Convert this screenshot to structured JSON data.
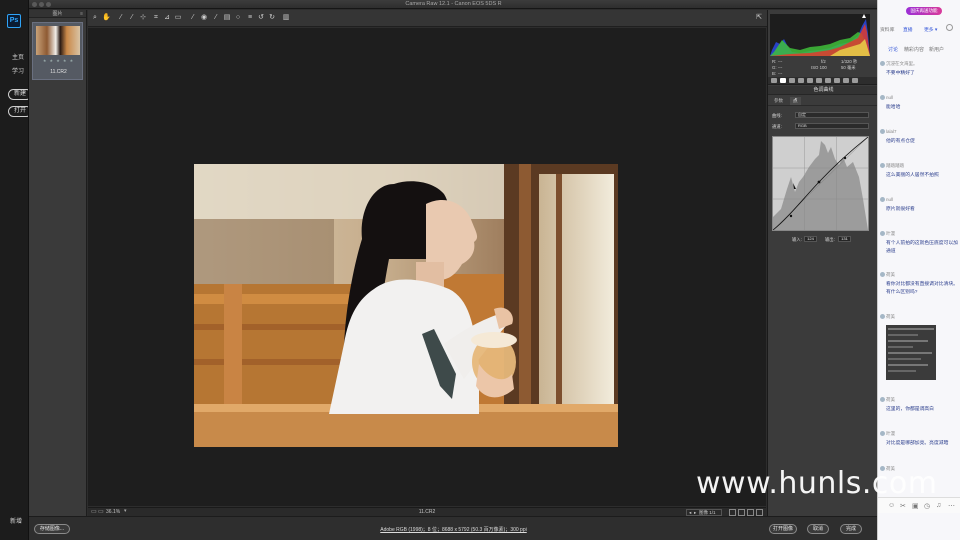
{
  "ps": {
    "logo": "Ps",
    "home": "主页",
    "learn": "学习",
    "new_btn": "新建",
    "open_btn": "打开",
    "footer": "新增"
  },
  "window": {
    "title": "Camera Raw 12.1 - Canon EOS 5DS R"
  },
  "filmstrip": {
    "header": "图片",
    "thumb_stars": "★ ★ ★ ★ ★",
    "thumb_name": "11.CR2"
  },
  "toolbar": {
    "tools": [
      "zoom-icon",
      "hand-icon",
      "white-balance-icon",
      "color-sampler-icon",
      "targeted-adjust-icon",
      "crop-icon",
      "straighten-icon",
      "transform-icon",
      "spot-removal-icon",
      "red-eye-icon",
      "adjustment-brush-icon",
      "graduated-filter-icon",
      "radial-filter-icon",
      "preferences-icon",
      "rotate-ccw-icon",
      "rotate-cw-icon",
      "trash-icon"
    ]
  },
  "preview": {
    "zoom": "36.1%",
    "file_name": "11.CR2",
    "nav": "图像 1/1"
  },
  "histogram_panel": {
    "aperture": "f/2",
    "shutter": "1/320 秒",
    "iso": "ISO 100",
    "focal": "50 毫米",
    "r": "R:",
    "g": "G:",
    "b": "B:",
    "dashes": "---"
  },
  "curve_panel": {
    "title": "色调曲线",
    "tab_parametric": "参数",
    "tab_point": "点",
    "curve_label": "曲线:",
    "curve_value": "自定",
    "channel_label": "通道:",
    "channel_value": "RGB",
    "input_label": "输入:",
    "input_value": "124",
    "output_label": "输出:",
    "output_value": "131"
  },
  "bottom": {
    "save": "存储图像...",
    "workflow": "Adobe RGB (1998)；8 位；8688 x 5792 (50.3 百万像素)；300 ppi",
    "open": "打开图像",
    "cancel": "取消",
    "done": "完成"
  },
  "chat": {
    "brand": "国庆再送功能",
    "top_left": "资料库",
    "top_live": "直播",
    "top_more": "更多 ▾",
    "tabs": [
      "讨论",
      "精彩内容",
      "新用户"
    ],
    "messages": [
      {
        "user": "沉浸在文海里。",
        "text": "不要中精好了"
      },
      {
        "user": "null",
        "text": "能哈哈"
      },
      {
        "user": "lalal7",
        "text": "他的有点仓促"
      },
      {
        "user": "踏踏踏踏",
        "text": "这么美丽的人居然不拍照"
      },
      {
        "user": "null",
        "text": "原片就很好看"
      },
      {
        "user": "叶漫",
        "text": "有个人前拍的这就色压底度可以加通道"
      },
      {
        "user": "荷美",
        "text": "看你对比都没有直接调对比清块。有什么区别吗?"
      },
      {
        "user": "荷美",
        "text": ""
      },
      {
        "user": "荷美",
        "text": "这里的，你都是调高白"
      },
      {
        "user": "叶漫",
        "text": "对比度是哪部加亮。亮度减暗"
      },
      {
        "user": "荷美",
        "text": "我觉"
      }
    ]
  },
  "watermark": "www.hunls.com"
}
